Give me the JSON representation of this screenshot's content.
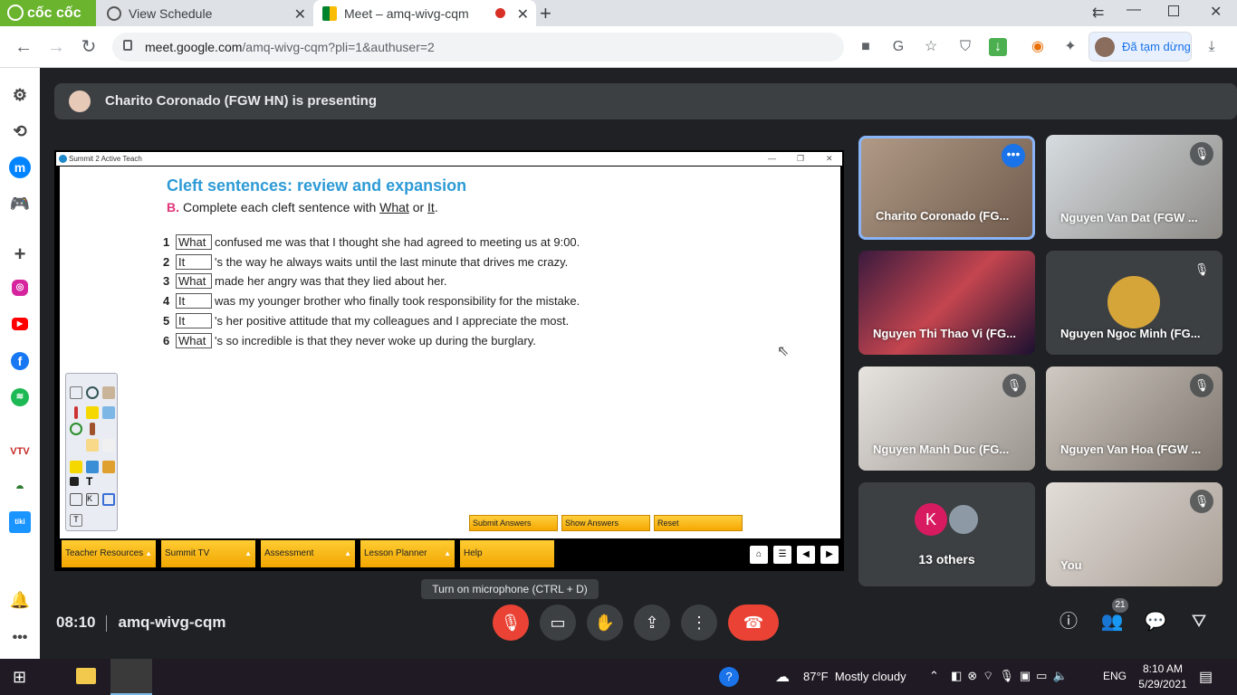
{
  "browser": {
    "brand": "cốc cốc",
    "tabs": [
      {
        "title": "View Schedule"
      },
      {
        "title": "Meet – amq-wivg-cqm"
      }
    ],
    "new_tab": "+",
    "url_host": "meet.google.com",
    "url_path": "/amq-wivg-cqm?pli=1&authuser=2",
    "profile_label": "Đã tạm dừng"
  },
  "presenting": {
    "text": "Charito Coronado (FGW HN) is presenting"
  },
  "shared_app": {
    "window_title": "Summit 2 Active Teach",
    "slide_title": "Cleft sentences: review and expansion",
    "instr_letter": "B.",
    "instr_pre": "Complete each cleft sentence with ",
    "instr_what": "What",
    "instr_or": " or ",
    "instr_it": "It",
    "instr_end": ".",
    "questions": [
      {
        "num": "1",
        "answer": "What",
        "text": "confused me was that I thought she had agreed to meeting us at 9:00."
      },
      {
        "num": "2",
        "answer": "It",
        "text": "'s the way he always waits until the last minute that drives me crazy."
      },
      {
        "num": "3",
        "answer": "What",
        "text": "made her angry was that they lied about her."
      },
      {
        "num": "4",
        "answer": "It",
        "text": "was my younger brother who finally took responsibility for the mistake."
      },
      {
        "num": "5",
        "answer": "It",
        "text": "'s her positive attitude that my colleagues and I appreciate the most."
      },
      {
        "num": "6",
        "answer": "What",
        "text": "'s so incredible is that they never woke up during the burglary."
      }
    ],
    "buttons": {
      "submit": "Submit Answers",
      "show": "Show Answers",
      "reset": "Reset"
    },
    "nav": [
      "Teacher Resources",
      "Summit TV",
      "Assessment",
      "Lesson Planner",
      "Help"
    ]
  },
  "participants": [
    {
      "name": "Charito Coronado (FG..."
    },
    {
      "name": "Nguyen Van Dat (FGW ..."
    },
    {
      "name": "Nguyen Thi Thao Vi (FG..."
    },
    {
      "name": "Nguyen Ngoc Minh (FG..."
    },
    {
      "name": "Nguyen Manh Duc (FG..."
    },
    {
      "name": "Nguyen Van Hoa (FGW ..."
    },
    {
      "name": "13 others",
      "avatar_letter": "K"
    },
    {
      "name": "You"
    }
  ],
  "meeting": {
    "time": "08:10",
    "code": "amq-wivg-cqm",
    "tooltip": "Turn on microphone (CTRL + D)",
    "people_count": "21"
  },
  "taskbar": {
    "weather": "87°F  Mostly cloudy",
    "lang": "ENG",
    "clock_time": "8:10 AM",
    "clock_date": "5/29/2021"
  },
  "colors": {
    "meet_bg": "#202124",
    "tile_bg": "#3c4043",
    "end_call": "#ea4335",
    "mic_off": "#ea4335",
    "active_border": "#8ab4f8"
  }
}
